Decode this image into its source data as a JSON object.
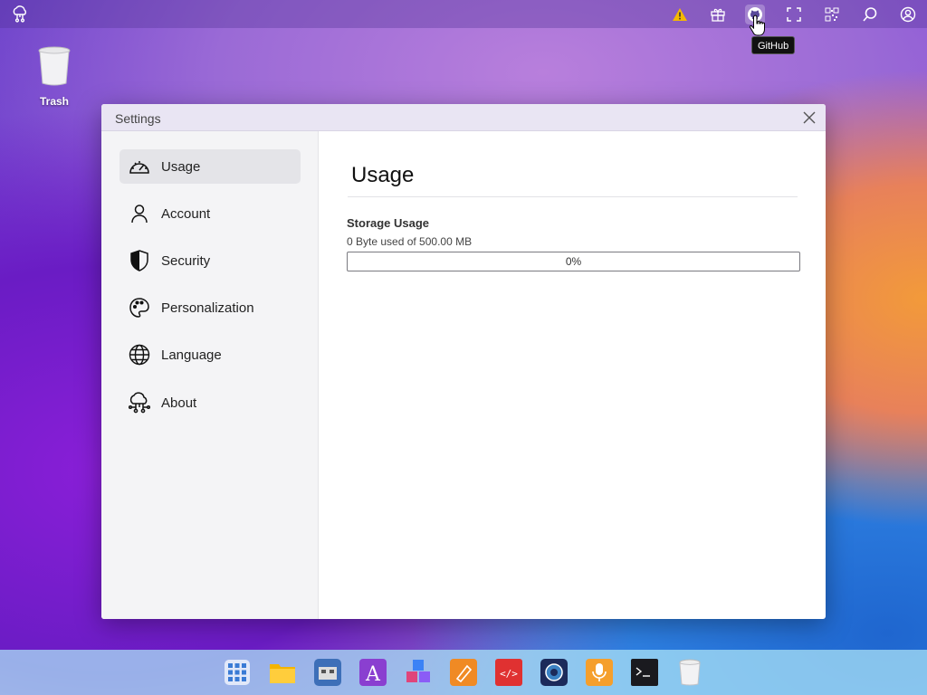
{
  "topbar": {
    "icons": [
      "cloud-logo-icon",
      "warning-icon",
      "gift-icon",
      "github-icon",
      "fullscreen-icon",
      "qr-code-icon",
      "search-icon",
      "user-icon"
    ],
    "tooltip": "GitHub"
  },
  "desktop": {
    "trash_label": "Trash"
  },
  "window": {
    "title": "Settings"
  },
  "sidebar": {
    "items": [
      {
        "label": "Usage",
        "icon": "speedometer-icon",
        "active": true
      },
      {
        "label": "Account",
        "icon": "person-icon",
        "active": false
      },
      {
        "label": "Security",
        "icon": "shield-icon",
        "active": false
      },
      {
        "label": "Personalization",
        "icon": "palette-icon",
        "active": false
      },
      {
        "label": "Language",
        "icon": "globe-icon",
        "active": false
      },
      {
        "label": "About",
        "icon": "cloud-network-icon",
        "active": false
      }
    ]
  },
  "main": {
    "heading": "Usage",
    "storage_title": "Storage Usage",
    "storage_summary": "0 Byte used of 500.00 MB",
    "progress_value": 0,
    "progress_label": "0%"
  },
  "dock": {
    "apps": [
      "app-grid-icon",
      "files-icon",
      "store-icon",
      "text-editor-icon",
      "cubes-icon",
      "draw-icon",
      "code-editor-icon",
      "camera-icon",
      "recorder-icon",
      "terminal-icon",
      "trash-icon"
    ]
  },
  "colors": {
    "accent": "#3b82f6",
    "window_titlebar": "#e9e5f3",
    "sidebar_bg": "#f4f4f6",
    "active_item_bg": "#e4e4e8"
  }
}
